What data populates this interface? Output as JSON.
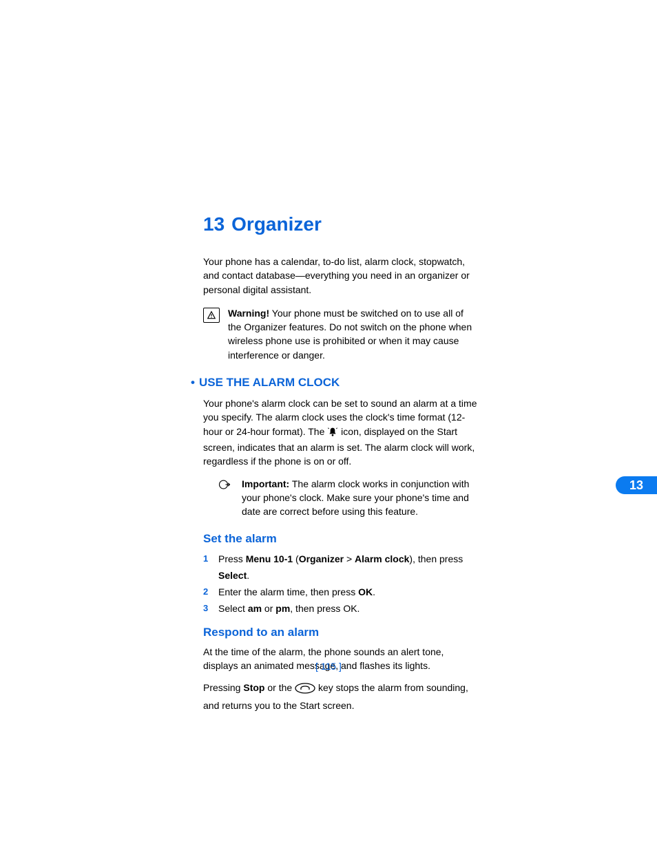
{
  "chapter": {
    "number": "13",
    "title": "Organizer"
  },
  "intro": "Your phone has a calendar, to-do list, alarm clock, stopwatch, and contact database—everything you need in an organizer or personal digital assistant.",
  "warning": {
    "label": "Warning!",
    "text": " Your phone must be switched on to use all of the Organizer features. Do not switch on the phone when wireless phone use is prohibited or when it may cause interference or danger."
  },
  "section1": {
    "heading": "USE THE ALARM CLOCK",
    "para_pre": "Your phone's alarm clock can be set to sound an alarm at a time you specify. The alarm clock uses the clock's time format (12-hour or 24-hour format). The ",
    "para_post": " icon, displayed on the Start screen, indicates that an alarm is set. The alarm clock will work, regardless if the phone is on or off."
  },
  "important": {
    "label": "Important:",
    "text": " The alarm clock works in conjunction with your phone's clock. Make sure your phone's time and date are correct before using this feature."
  },
  "set_alarm": {
    "heading": "Set the alarm",
    "steps": [
      {
        "n": "1",
        "pre": "Press ",
        "b1": "Menu 10-1",
        "mid1": " (",
        "b2": "Organizer",
        "mid2": " > ",
        "b3": "Alarm clock",
        "mid3": "), then press ",
        "b4": "Select",
        "post": "."
      },
      {
        "n": "2",
        "pre": "Enter the alarm time, then press ",
        "b1": "OK",
        "post": "."
      },
      {
        "n": "3",
        "pre": "Select ",
        "b1": "am",
        "mid1": " or ",
        "b2": "pm",
        "post": ", then press OK."
      }
    ]
  },
  "respond": {
    "heading": "Respond to an alarm",
    "p1": "At the time of the alarm, the phone sounds an alert tone, displays an animated message, and flashes its lights.",
    "p2_pre": "Pressing ",
    "p2_b": "Stop",
    "p2_mid": " or the ",
    "p2_post": " key stops the alarm from sounding, and returns you to the Start screen."
  },
  "tab": "13",
  "footer": "[ 115 ]"
}
